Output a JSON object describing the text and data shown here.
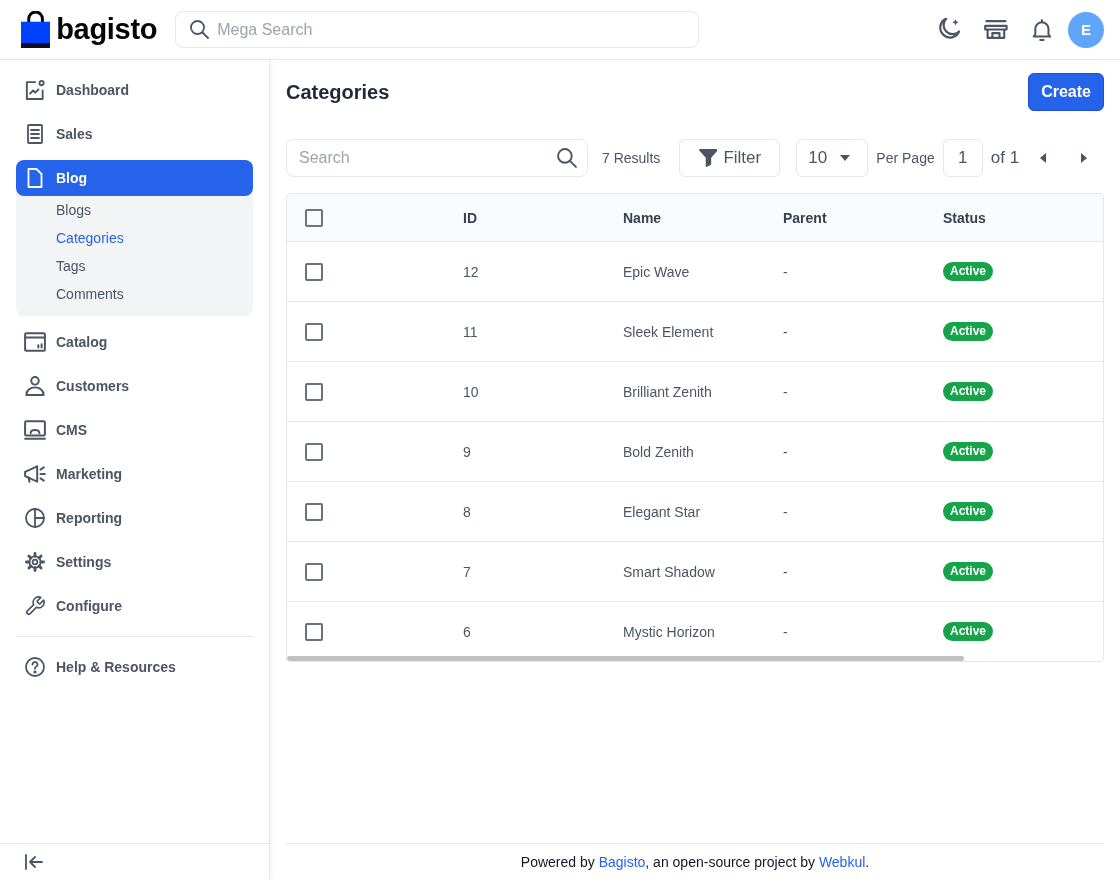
{
  "header": {
    "logo": "bagisto",
    "search": {
      "placeholder": "Mega Search"
    },
    "avatar": "E"
  },
  "sidebar": {
    "items": [
      {
        "label": "Dashboard",
        "selected": false
      },
      {
        "label": "Sales",
        "selected": false
      },
      {
        "label": "Blog",
        "selected": true,
        "children": [
          {
            "label": "Blogs",
            "selected": false
          },
          {
            "label": "Categories",
            "selected": true
          },
          {
            "label": "Tags",
            "selected": false
          },
          {
            "label": "Comments",
            "selected": false
          }
        ]
      },
      {
        "label": "Catalog",
        "selected": false
      },
      {
        "label": "Customers",
        "selected": false
      },
      {
        "label": "CMS",
        "selected": false
      },
      {
        "label": "Marketing",
        "selected": false
      },
      {
        "label": "Reporting",
        "selected": false
      },
      {
        "label": "Settings",
        "selected": false
      },
      {
        "label": "Configure",
        "selected": false
      }
    ],
    "help": {
      "label": "Help & Resources",
      "selected": false
    }
  },
  "page": {
    "title": "Categories",
    "create_button": "Create"
  },
  "toolbar": {
    "search": {
      "placeholder": "Search"
    },
    "results": "7 Results",
    "filter_button": "Filter",
    "per_page": {
      "value": "10",
      "label": "Per Page"
    },
    "pager": {
      "page": "1",
      "total": "of 1"
    }
  },
  "table": {
    "header_checked": false,
    "columns": [
      "ID",
      "Name",
      "Parent",
      "Status"
    ],
    "rows": [
      {
        "checked": false,
        "id": "12",
        "name": "Epic Wave",
        "parent": "-",
        "status": {
          "label": "Active",
          "kind": "active"
        }
      },
      {
        "checked": false,
        "id": "11",
        "name": "Sleek Element",
        "parent": "-",
        "status": {
          "label": "Active",
          "kind": "active"
        }
      },
      {
        "checked": false,
        "id": "10",
        "name": "Brilliant Zenith",
        "parent": "-",
        "status": {
          "label": "Active",
          "kind": "active"
        }
      },
      {
        "checked": false,
        "id": "9",
        "name": "Bold Zenith",
        "parent": "-",
        "status": {
          "label": "Active",
          "kind": "active"
        }
      },
      {
        "checked": false,
        "id": "8",
        "name": "Elegant Star",
        "parent": "-",
        "status": {
          "label": "Active",
          "kind": "active"
        }
      },
      {
        "checked": false,
        "id": "7",
        "name": "Smart Shadow",
        "parent": "-",
        "status": {
          "label": "Active",
          "kind": "active"
        }
      },
      {
        "checked": false,
        "id": "6",
        "name": "Mystic Horizon",
        "parent": "-",
        "status": {
          "label": "Active",
          "kind": "active"
        }
      }
    ]
  },
  "footer": {
    "parts": [
      {
        "kind": "text",
        "text": "Powered by "
      },
      {
        "kind": "link",
        "text": "Bagisto"
      },
      {
        "kind": "text",
        "text": ", an open-source project by "
      },
      {
        "kind": "link",
        "text": "Webkul"
      },
      {
        "kind": "text",
        "text": "."
      }
    ]
  }
}
